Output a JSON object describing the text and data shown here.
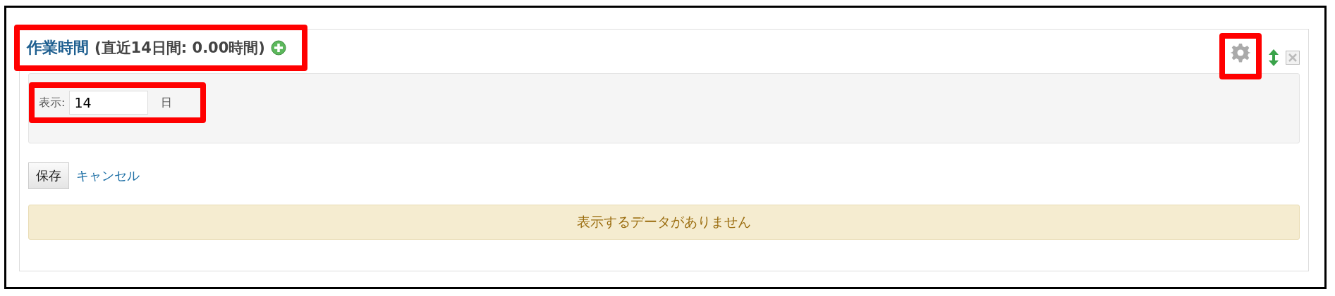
{
  "widget": {
    "title": "作業時間",
    "summary": "(直近14日間: 0.00時間)"
  },
  "settings": {
    "label": "表示:",
    "value": "14",
    "unit": "日"
  },
  "buttons": {
    "save": "保存",
    "cancel": "キャンセル"
  },
  "message": "表示するデータがありません"
}
